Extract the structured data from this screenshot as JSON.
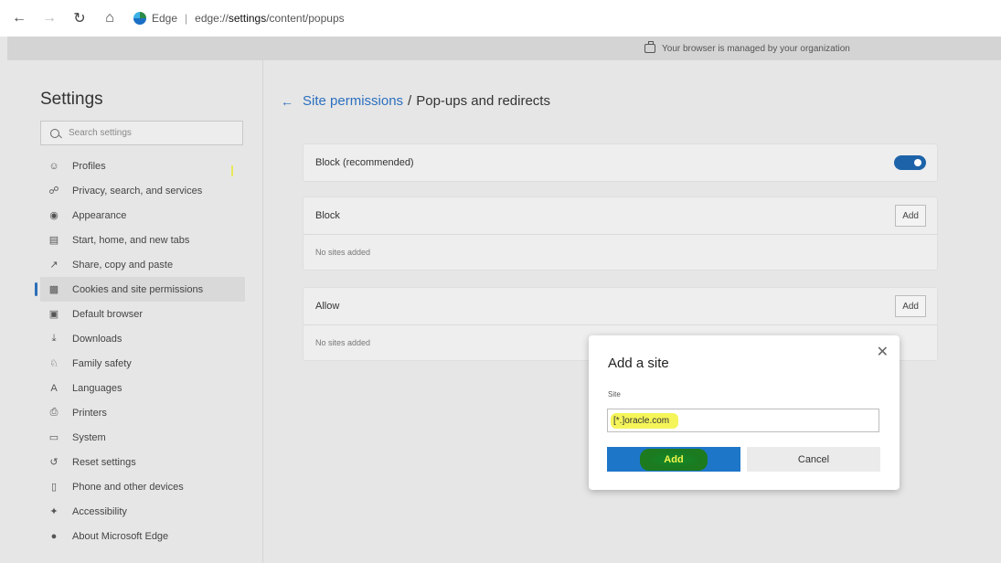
{
  "browser": {
    "app_name": "Edge",
    "url_scheme": "edge://",
    "url_host_path": "settings",
    "url_rest": "/content/popups",
    "managed_notice": "Your browser is managed by your organization"
  },
  "sidebar": {
    "title": "Settings",
    "search_placeholder": "Search settings",
    "items": [
      {
        "label": "Profiles",
        "icon": "profile-icon"
      },
      {
        "label": "Privacy, search, and services",
        "icon": "lock-icon"
      },
      {
        "label": "Appearance",
        "icon": "palette-icon"
      },
      {
        "label": "Start, home, and new tabs",
        "icon": "home-tabs-icon"
      },
      {
        "label": "Share, copy and paste",
        "icon": "share-icon"
      },
      {
        "label": "Cookies and site permissions",
        "icon": "cookies-icon",
        "active": true
      },
      {
        "label": "Default browser",
        "icon": "default-browser-icon"
      },
      {
        "label": "Downloads",
        "icon": "download-icon"
      },
      {
        "label": "Family safety",
        "icon": "family-icon"
      },
      {
        "label": "Languages",
        "icon": "languages-icon"
      },
      {
        "label": "Printers",
        "icon": "printer-icon"
      },
      {
        "label": "System",
        "icon": "system-icon"
      },
      {
        "label": "Reset settings",
        "icon": "reset-icon"
      },
      {
        "label": "Phone and other devices",
        "icon": "phone-icon"
      },
      {
        "label": "Accessibility",
        "icon": "accessibility-icon"
      },
      {
        "label": "About Microsoft Edge",
        "icon": "edge-logo-icon"
      }
    ]
  },
  "main": {
    "breadcrumb_parent": "Site permissions",
    "breadcrumb_current": "Pop-ups and redirects",
    "block_recommended": {
      "label": "Block (recommended)",
      "enabled": true
    },
    "block": {
      "label": "Block",
      "add_label": "Add",
      "empty_text": "No sites added"
    },
    "allow": {
      "label": "Allow",
      "add_label": "Add",
      "empty_text": "No sites added"
    }
  },
  "dialog": {
    "title": "Add a site",
    "field_label": "Site",
    "field_value": "[*.]oracle.com",
    "add_label": "Add",
    "cancel_label": "Cancel"
  },
  "colors": {
    "accent": "#1e76c8",
    "highlight": "#f5f55a"
  }
}
